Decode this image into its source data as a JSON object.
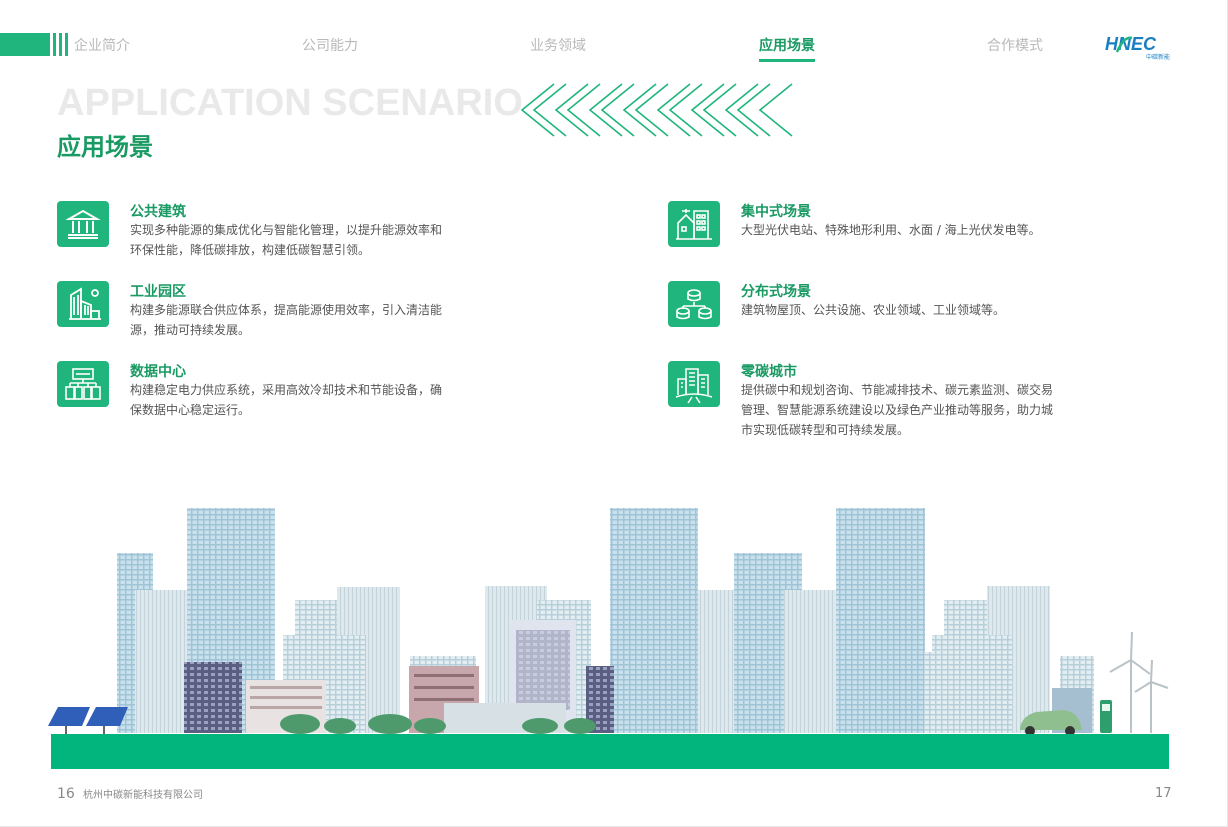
{
  "nav": {
    "items": [
      {
        "label": "企业简介",
        "active": false
      },
      {
        "label": "公司能力",
        "active": false
      },
      {
        "label": "业务领域",
        "active": false
      },
      {
        "label": "应用场景",
        "active": true
      },
      {
        "label": "合作模式",
        "active": false
      }
    ]
  },
  "logo": {
    "text": "HNEC",
    "sub": "中碳新能"
  },
  "heading": {
    "en": "APPLICATION SCENARIO",
    "cn": "应用场景"
  },
  "scenarios": [
    {
      "title": "公共建筑",
      "desc": "实现多种能源的集成优化与智能化管理，以提升能源效率和环保性能，降低碳排放，构建低碳智慧引领。",
      "icon": "bank-building-icon"
    },
    {
      "title": "工业园区",
      "desc": "构建多能源联合供应体系，提高能源使用效率，引入清洁能源，推动可持续发展。",
      "icon": "industrial-park-icon"
    },
    {
      "title": "数据中心",
      "desc": "构建稳定电力供应系统，采用高效冷却技术和节能设备，确保数据中心稳定运行。",
      "icon": "data-center-icon"
    },
    {
      "title": "集中式场景",
      "desc": "大型光伏电站、特殊地形利用、水面 / 海上光伏发电等。",
      "icon": "centralized-building-icon"
    },
    {
      "title": "分布式场景",
      "desc": "建筑物屋顶、公共设施、农业领域、工业领域等。",
      "icon": "distributed-network-icon"
    },
    {
      "title": "零碳城市",
      "desc": "提供碳中和规划咨询、节能减排技术、碳元素监测、碳交易管理、智慧能源系统建设以及绿色产业推动等服务，助力城市实现低碳转型和可持续发展。",
      "icon": "zero-carbon-city-icon"
    }
  ],
  "footer": {
    "left_page": "16",
    "company": "杭州中碳新能科技有限公司",
    "right_page": "17"
  },
  "colors": {
    "accent": "#1fb57c",
    "accent_dark": "#1a9a63",
    "ground": "#01b57d"
  }
}
